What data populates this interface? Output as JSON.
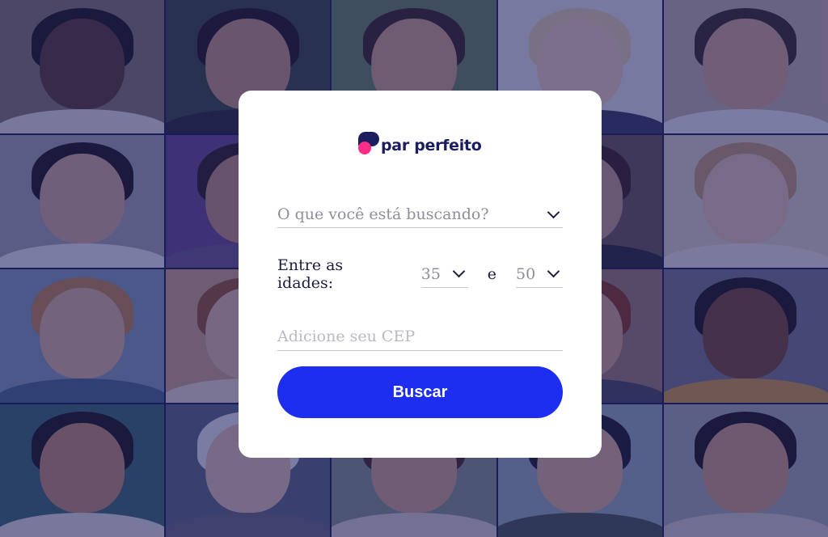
{
  "brand": {
    "logo_text": "par perfeito"
  },
  "search_form": {
    "looking_for_placeholder": "O que você está buscando?",
    "age_label": "Entre as idades:",
    "age_min": "35",
    "age_separator": "e",
    "age_max": "50",
    "zip_placeholder": "Adicione seu CEP",
    "submit_label": "Buscar"
  },
  "colors": {
    "brand_dark": "#1c1d5e",
    "brand_pink": "#ff2d86",
    "button_blue": "#1e2ef0",
    "overlay": "#1c1e64"
  },
  "background": {
    "photos": [
      {
        "skin": "#5a3a2a",
        "hair": "#1a1410",
        "shirt": "#e8e4e0",
        "bg": "#8a7a6a"
      },
      {
        "skin": "#c99a7a",
        "hair": "#201612",
        "shirt": "#2a2a30",
        "bg": "#3a4a3a"
      },
      {
        "skin": "#d4a684",
        "hair": "#3a2618",
        "shirt": "#3a2a22",
        "bg": "#6a8a5a"
      },
      {
        "skin": "#f0d2bc",
        "hair": "#e8d8b0",
        "shirt": "#3a3a5a",
        "bg": "#e8e8ea"
      },
      {
        "skin": "#d8ae90",
        "hair": "#3a2a1e",
        "shirt": "#f0f0f0",
        "bg": "#c8b8a8"
      },
      {
        "skin": "#d8b096",
        "hair": "#1e1612",
        "shirt": "#f0f0f0",
        "bg": "#a8a8b0"
      },
      {
        "skin": "#c4967a",
        "hair": "#2a1e18",
        "shirt": "#6a5a8a",
        "bg": "#6a4a8a"
      },
      {
        "skin": "#c89880",
        "hair": "#2a1e18",
        "shirt": "#3a3a40",
        "bg": "#8a6a5a"
      },
      {
        "skin": "#c8a088",
        "hair": "#3a2418",
        "shirt": "#2a2a30",
        "bg": "#6a5a50"
      },
      {
        "skin": "#eccab4",
        "hair": "#c8a070",
        "shirt": "#f0e8e0",
        "bg": "#e0d8c8"
      },
      {
        "skin": "#e0b89a",
        "hair": "#c48a4a",
        "shirt": "#4a6a8a",
        "bg": "#8aa0b8"
      },
      {
        "skin": "#e6c2a6",
        "hair": "#9a5a2a",
        "shirt": "#f0e0d0",
        "bg": "#d0a888"
      },
      {
        "skin": "#c8a088",
        "hair": "#3a2418",
        "shirt": "#2a2a30",
        "bg": "#8a6a5a"
      },
      {
        "skin": "#d8a88a",
        "hair": "#8a3a1a",
        "shirt": "#4a4a5a",
        "bg": "#a08070"
      },
      {
        "skin": "#7a4a30",
        "hair": "#1a1410",
        "shirt": "#d4a040",
        "bg": "#7a7a8a"
      },
      {
        "skin": "#c8906a",
        "hair": "#1a1410",
        "shirt": "#e8e4e0",
        "bg": "#3a6a6a"
      },
      {
        "skin": "#e8c8b0",
        "hair": "#f0f0f0",
        "shirt": "#6a6a7a",
        "bg": "#5a6a7a"
      },
      {
        "skin": "#d8a888",
        "hair": "#4a2a18",
        "shirt": "#e0d8d0",
        "bg": "#8a9a8a"
      },
      {
        "skin": "#e0b496",
        "hair": "#1c1c20",
        "shirt": "#4a5a4a",
        "bg": "#9ab0b8"
      },
      {
        "skin": "#d4a282",
        "hair": "#1e1612",
        "shirt": "#d8d0c8",
        "bg": "#a8b0b0"
      }
    ]
  }
}
